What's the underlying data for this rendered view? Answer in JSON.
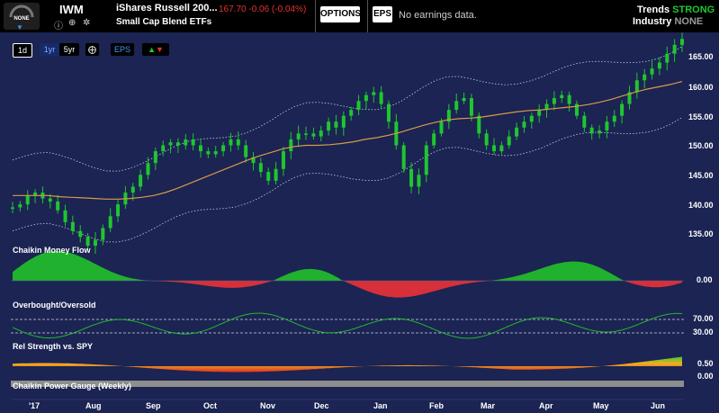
{
  "header": {
    "gauge_label": "NONE",
    "ticker": "IWM",
    "name": "iShares Russell 200...",
    "category": "Small Cap Blend ETFs",
    "price_text": "167.70 -0.06 (-0.04%)",
    "options_label": "OPTIONS",
    "eps_label": "EPS",
    "no_earnings": "No earnings data.",
    "trends_label": "Trends",
    "trends_value": "STRONG",
    "industry_label": "Industry",
    "industry_value": "NONE"
  },
  "toolbar": {
    "d1": "1d",
    "y1": "1yr",
    "y5": "5yr",
    "eps": "EPS"
  },
  "panels": {
    "money_flow": "Chaikin Money Flow",
    "overbought": "Overbought/Oversold",
    "rel_strength": "Rel Strength vs. SPY",
    "power_gauge": "Chaikin Power Gauge (Weekly)"
  },
  "colors": {
    "background": "#1b2452",
    "candle_up": "#1fc62f",
    "moving_average": "#d89a4a",
    "positive_flow": "#20b12e",
    "negative_flow": "#d7303a"
  },
  "chart_data": {
    "type": "line",
    "x": [
      "'17",
      "Aug",
      "Sep",
      "Oct",
      "Nov",
      "Dec",
      "Jan",
      "Feb",
      "Mar",
      "Apr",
      "May",
      "Jun"
    ],
    "x_ticks": [
      "'17",
      "Aug",
      "Sep",
      "Oct",
      "Nov",
      "Dec",
      "Jan",
      "Feb",
      "Mar",
      "Apr",
      "May",
      "Jun"
    ],
    "y_ticks": [
      "135.00",
      "140.00",
      "145.00",
      "150.00",
      "155.00",
      "160.00",
      "165.00"
    ],
    "ylim": [
      130,
      168
    ],
    "series": [
      {
        "values": [
          139.5,
          140,
          141.5,
          142,
          141,
          140.5,
          139,
          137,
          135.5,
          134.5,
          133,
          134,
          136,
          138,
          140,
          142,
          143,
          145,
          147,
          149,
          150,
          150.5,
          150,
          151,
          150,
          149,
          148.5,
          149,
          150,
          151,
          150,
          148,
          147,
          145.5,
          144,
          146,
          149,
          151,
          152,
          152,
          151.5,
          152.5,
          154,
          153,
          155,
          156,
          157.5,
          158.5,
          159,
          157,
          154,
          150,
          146,
          143,
          145,
          150,
          152,
          154,
          156,
          157.5,
          158,
          155,
          152,
          150,
          149,
          150,
          151.5,
          153,
          154,
          155,
          156,
          157,
          158,
          158.5,
          157,
          155,
          153,
          152,
          152.5,
          154,
          155,
          157,
          159,
          161,
          162,
          163,
          164,
          165.5,
          167,
          168
        ]
      },
      {
        "values": [
          141.5,
          141.5,
          141.5,
          141.5,
          141.3,
          141.2,
          141.1,
          141,
          140.9,
          140.9,
          141,
          141.2,
          141.5,
          142,
          142.7,
          143.5,
          144.3,
          145.1,
          145.9,
          146.7,
          147.5,
          148.2,
          148.8,
          149.4,
          149.8,
          150,
          150,
          150.1,
          150.3,
          150.6,
          151,
          151.3,
          151.7,
          152.2,
          152.8,
          153.4,
          153.9,
          154.3,
          154.5,
          154.6,
          154.8,
          155.1,
          155.4,
          155.7,
          155.9,
          156,
          156.2,
          156.4,
          156.6,
          156.9,
          157.3,
          157.8,
          158.4,
          159,
          159.5,
          159.9,
          160.3,
          160.8
        ]
      }
    ],
    "panels": [
      {
        "name": "Chaikin Money Flow",
        "y_ticks": [
          "0.00"
        ]
      },
      {
        "name": "Overbought/Oversold",
        "y_ticks": [
          "70.00",
          "30.00"
        ]
      },
      {
        "name": "Rel Strength vs. SPY",
        "y_ticks": [
          "0.50",
          "0.00"
        ]
      },
      {
        "name": "Chaikin Power Gauge (Weekly)",
        "y_ticks": []
      }
    ]
  }
}
